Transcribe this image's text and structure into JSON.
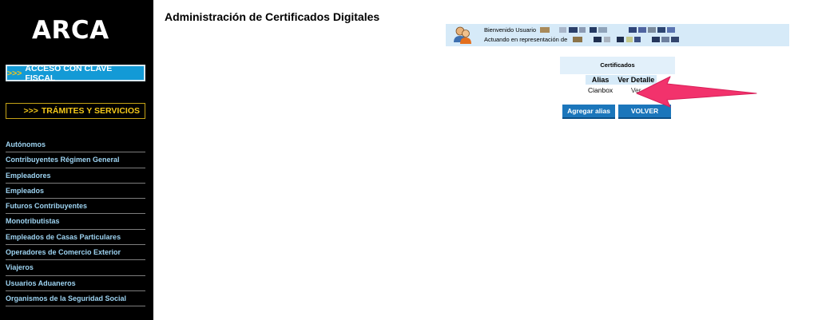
{
  "sidebar": {
    "logo": "ARCA",
    "clave_fiscal": {
      "arrows": ">>>",
      "label": "ACCESO CON CLAVE FISCAL"
    },
    "tramites": {
      "arrows": ">>>",
      "label": "TRÁMITES Y SERVICIOS"
    },
    "menu": [
      "Autónomos",
      "Contribuyentes Régimen General",
      "Empleadores",
      "Empleados",
      "Futuros Contribuyentes",
      "Monotributistas",
      "Empleados de Casas Particulares",
      "Operadores de Comercio Exterior",
      "Viajeros",
      "Usuarios Aduaneros",
      "Organismos de la Seguridad Social"
    ]
  },
  "main": {
    "title": "Administración de Certificados Digitales",
    "welcome": {
      "line1": "Bienvenido Usuario",
      "line2": "Actuando en representación de"
    },
    "certificados": {
      "header": "Certificados",
      "columns": [
        "Alias",
        "Ver Detalle"
      ],
      "rows": [
        {
          "alias": "Cianbox",
          "ver": "Ver"
        }
      ]
    },
    "buttons": {
      "agregar": "Agregar alias",
      "volver": "VOLVER"
    }
  },
  "colors": {
    "accent_blue": "#1b76bb",
    "sidebar_link": "#9ed4f2",
    "gold": "#f4c81a",
    "annotation": "#f2326c"
  },
  "icons": [
    "users-icon",
    "annotation-arrow"
  ]
}
